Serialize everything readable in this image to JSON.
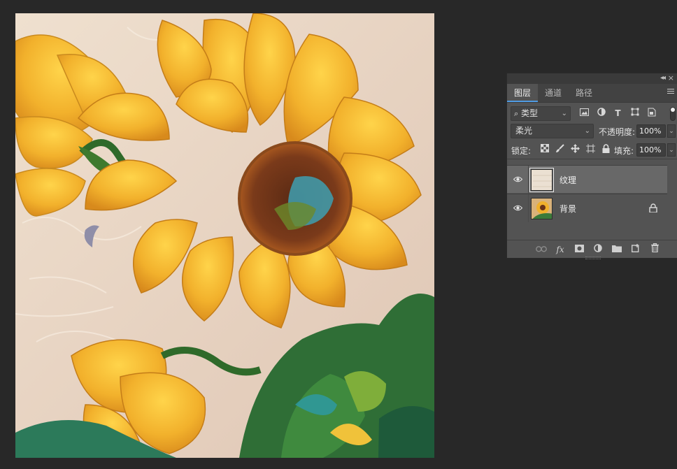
{
  "document": {
    "canvas": {
      "subject": "impasto oil painting of yellow sunflowers on a cream background"
    }
  },
  "layers_panel": {
    "tabs": [
      {
        "label": "图层",
        "active": true
      },
      {
        "label": "通道",
        "active": false
      },
      {
        "label": "路径",
        "active": false
      }
    ],
    "filter": {
      "label": "类型",
      "icons": [
        "image-filter-icon",
        "adjustment-filter-icon",
        "type-filter-icon",
        "shape-filter-icon",
        "smart-object-filter-icon"
      ]
    },
    "blend_mode": "柔光",
    "opacity_label": "不透明度:",
    "opacity_value": "100%",
    "lock_label": "锁定:",
    "fill_label": "填充:",
    "fill_value": "100%",
    "layers": [
      {
        "name": "纹理",
        "visible": true,
        "selected": true,
        "locked": false
      },
      {
        "name": "背景",
        "visible": true,
        "selected": false,
        "locked": true
      }
    ],
    "bottom_icons": [
      "link-layers-icon",
      "fx-icon",
      "add-mask-icon",
      "adjustment-layer-icon",
      "new-group-icon",
      "new-layer-icon",
      "delete-layer-icon"
    ],
    "fx_label": "fx"
  },
  "colors": {
    "app_background": "#282828",
    "panel_background": "#535353",
    "selected_layer": "#686868",
    "accent": "#4f9be3"
  }
}
